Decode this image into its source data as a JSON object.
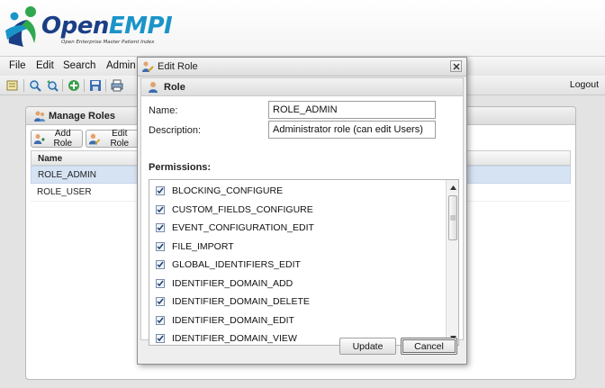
{
  "app": {
    "logo_text_main": "Open",
    "logo_text_accent": "EMPI",
    "logo_tagline": "Open Enterprise Master Patient Index"
  },
  "menubar": {
    "items": [
      "File",
      "Edit",
      "Search",
      "Admin"
    ]
  },
  "toolbar": {
    "icons": [
      "report-icon",
      "search-icon",
      "advanced-search-icon",
      "add-icon",
      "save-icon",
      "print-icon"
    ],
    "logout_label": "Logout"
  },
  "manage_roles": {
    "title": "Manage Roles",
    "add_role_label": "Add Role",
    "edit_role_label": "Edit Role",
    "column_name": "Name",
    "rows": [
      "ROLE_ADMIN",
      "ROLE_USER"
    ],
    "selected_row": 0
  },
  "dialog": {
    "title": "Edit Role",
    "section_title": "Role",
    "name_label": "Name:",
    "name_value": "ROLE_ADMIN",
    "description_label": "Description:",
    "description_value": "Administrator role (can edit Users)",
    "permissions_label": "Permissions:",
    "permissions": [
      {
        "label": "BLOCKING_CONFIGURE",
        "checked": true
      },
      {
        "label": "CUSTOM_FIELDS_CONFIGURE",
        "checked": true
      },
      {
        "label": "EVENT_CONFIGURATION_EDIT",
        "checked": true
      },
      {
        "label": "FILE_IMPORT",
        "checked": true
      },
      {
        "label": "GLOBAL_IDENTIFIERS_EDIT",
        "checked": true
      },
      {
        "label": "IDENTIFIER_DOMAIN_ADD",
        "checked": true
      },
      {
        "label": "IDENTIFIER_DOMAIN_DELETE",
        "checked": true
      },
      {
        "label": "IDENTIFIER_DOMAIN_EDIT",
        "checked": true
      },
      {
        "label": "IDENTIFIER_DOMAIN_VIEW",
        "checked": true
      }
    ],
    "update_label": "Update",
    "cancel_label": "Cancel"
  },
  "colors": {
    "logo_dark": "#1b3f86",
    "logo_accent": "#1a94c8",
    "selected_row": "#d6e3f3"
  }
}
